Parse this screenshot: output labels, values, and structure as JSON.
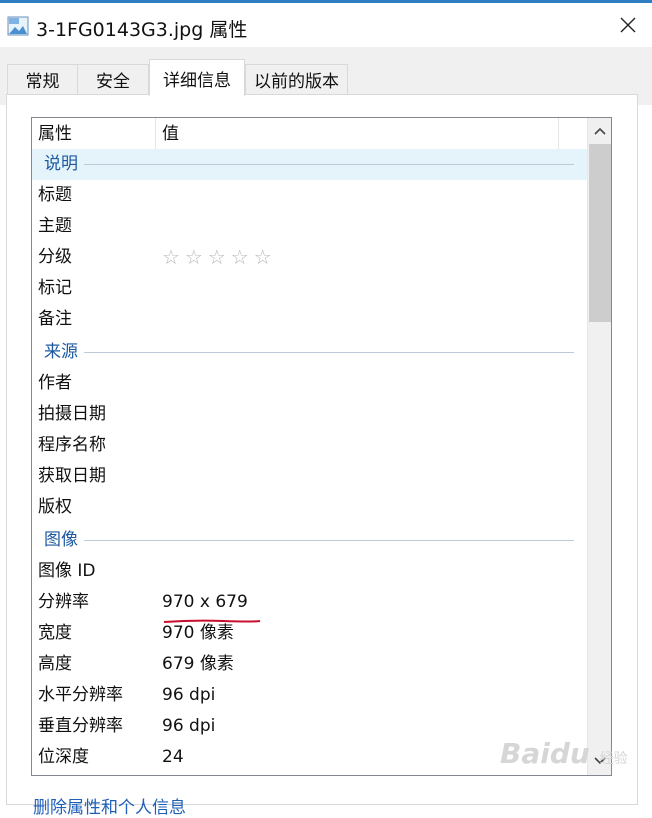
{
  "window": {
    "title": "3-1FG0143G3.jpg 属性",
    "accent_color": "#2d7fc1",
    "icons": {
      "app": "jpg-file-icon",
      "close": "close-icon"
    }
  },
  "tabs": [
    {
      "label": "常规",
      "active": false
    },
    {
      "label": "安全",
      "active": false
    },
    {
      "label": "详细信息",
      "active": true
    },
    {
      "label": "以前的版本",
      "active": false
    }
  ],
  "list": {
    "headers": {
      "property": "属性",
      "value": "值"
    },
    "groups": {
      "description": {
        "title": "说明",
        "rows": [
          {
            "key": "标题",
            "value": ""
          },
          {
            "key": "主题",
            "value": ""
          },
          {
            "key": "分级",
            "value": ""
          },
          {
            "key": "标记",
            "value": ""
          },
          {
            "key": "备注",
            "value": ""
          }
        ],
        "rating": {
          "stars_total": 5,
          "stars_filled": 0,
          "symbol": "☆☆☆☆☆"
        }
      },
      "origin": {
        "title": "来源",
        "rows": [
          {
            "key": "作者",
            "value": ""
          },
          {
            "key": "拍摄日期",
            "value": ""
          },
          {
            "key": "程序名称",
            "value": ""
          },
          {
            "key": "获取日期",
            "value": ""
          },
          {
            "key": "版权",
            "value": ""
          }
        ]
      },
      "image": {
        "title": "图像",
        "rows": [
          {
            "key": "图像 ID",
            "value": ""
          },
          {
            "key": "分辨率",
            "value": "970 x 679"
          },
          {
            "key": "宽度",
            "value": "970 像素"
          },
          {
            "key": "高度",
            "value": "679 像素"
          },
          {
            "key": "水平分辨率",
            "value": "96 dpi"
          },
          {
            "key": "垂直分辨率",
            "value": "96 dpi"
          },
          {
            "key": "位深度",
            "value": "24"
          }
        ]
      }
    },
    "highlight_color": "#c8102e"
  },
  "footer": {
    "link": "删除属性和个人信息"
  },
  "watermark": {
    "text": "Bai",
    "suffix": "du",
    "sub": "经验"
  }
}
